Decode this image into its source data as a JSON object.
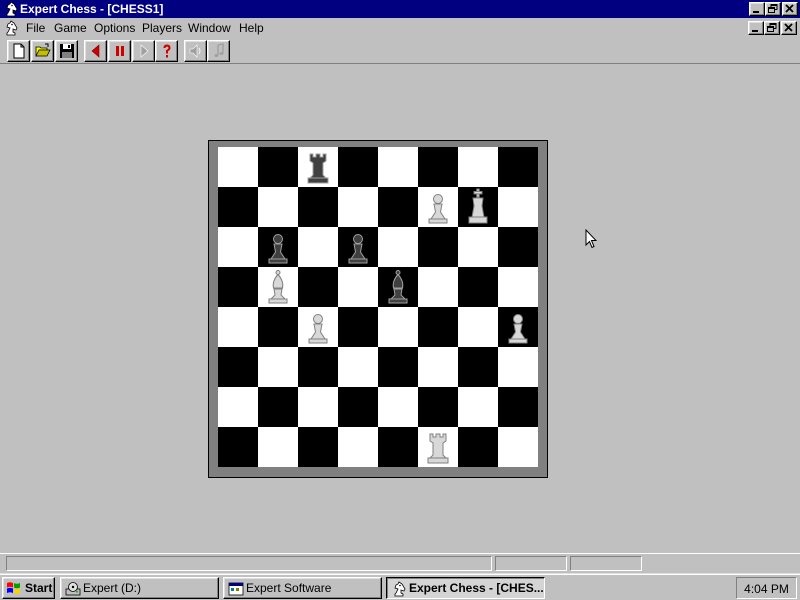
{
  "window": {
    "title": "Expert Chess - [CHESS1]"
  },
  "menu": {
    "items": [
      "File",
      "Game",
      "Options",
      "Players",
      "Window",
      "Help"
    ]
  },
  "toolbar": {
    "buttons": [
      {
        "name": "new-icon"
      },
      {
        "name": "open-folder-icon"
      },
      {
        "name": "save-disk-icon"
      },
      {
        "name": "take-back-arrow-icon"
      },
      {
        "name": "pause-icon"
      },
      {
        "name": "forward-arrow-icon",
        "disabled": true
      },
      {
        "name": "hint-question-icon"
      },
      {
        "name": "sound-speaker-icon",
        "disabled": true
      },
      {
        "name": "music-note-icon",
        "disabled": true
      }
    ]
  },
  "board": {
    "size": 8,
    "light_color": "#ffffff",
    "dark_color": "#000000",
    "pieces": [
      {
        "type": "rook",
        "color": "black",
        "square": "c8"
      },
      {
        "type": "pawn",
        "color": "white",
        "square": "f7"
      },
      {
        "type": "king",
        "color": "white",
        "square": "g7"
      },
      {
        "type": "pawn",
        "color": "black",
        "square": "b6"
      },
      {
        "type": "pawn",
        "color": "black",
        "square": "d6"
      },
      {
        "type": "bishop",
        "color": "white",
        "square": "b5"
      },
      {
        "type": "bishop",
        "color": "black",
        "square": "e5"
      },
      {
        "type": "pawn",
        "color": "white",
        "square": "c4"
      },
      {
        "type": "pawn",
        "color": "white",
        "square": "h4"
      },
      {
        "type": "rook",
        "color": "white",
        "square": "f1"
      }
    ]
  },
  "taskbar": {
    "start_label": "Start",
    "tasks": [
      {
        "label": "Expert (D:)",
        "icon": "drive-icon",
        "active": false
      },
      {
        "label": "Expert Software",
        "icon": "program-group-icon",
        "active": false
      },
      {
        "label": "Expert Chess - [CHES...",
        "icon": "chess-knight-icon",
        "active": true
      }
    ],
    "clock": "4:04 PM"
  },
  "colors": {
    "title_bar": "#000080",
    "face": "#c0c0c0",
    "board_frame": "#808080",
    "red_button": "#d00000"
  }
}
